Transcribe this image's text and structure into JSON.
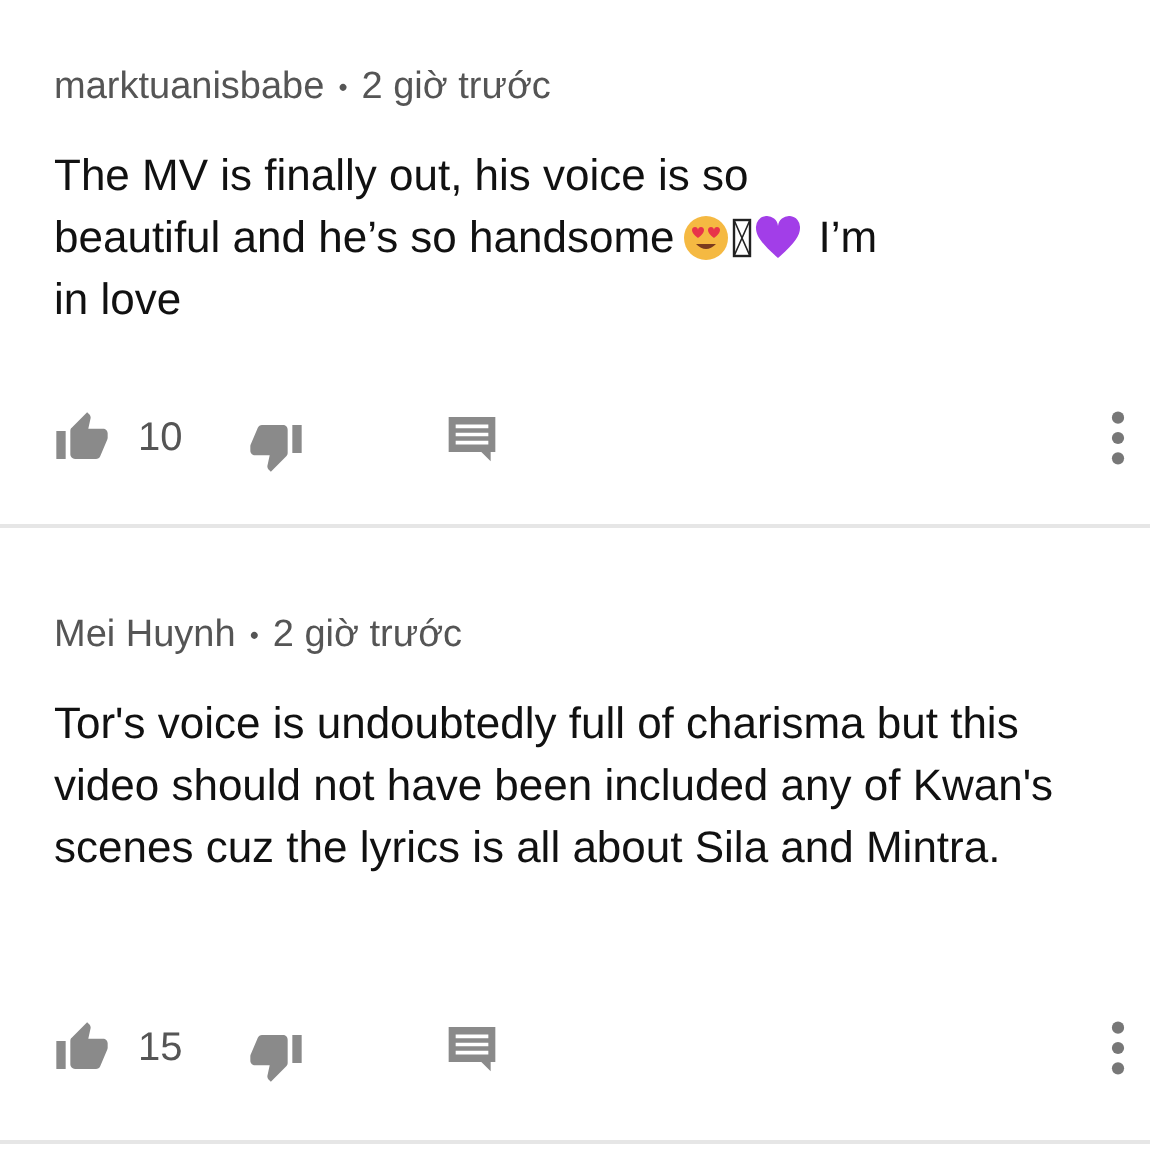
{
  "comments": [
    {
      "author": "marktuanisbabe",
      "separator": "•",
      "time": "2 giờ trước",
      "lines": [
        [
          {
            "kind": "text",
            "text": "The MV is finally out, his voice is so"
          }
        ],
        [
          {
            "kind": "text",
            "text": "beautiful and he’s so handsome"
          },
          {
            "kind": "heart-eyes"
          },
          {
            "kind": "missing"
          },
          {
            "kind": "heart"
          },
          {
            "kind": "text",
            "text": "I’m"
          }
        ],
        [
          {
            "kind": "text",
            "text": "in love"
          }
        ]
      ],
      "likes": "10"
    },
    {
      "author": "Mei Huynh",
      "separator": "•",
      "time": "2 giờ trước",
      "text": "Tor's voice is undoubtedly full of charisma but this video should not have been included any of Kwan's scenes cuz the lyrics is all about Sila and Mintra.",
      "likes": "15"
    }
  ]
}
